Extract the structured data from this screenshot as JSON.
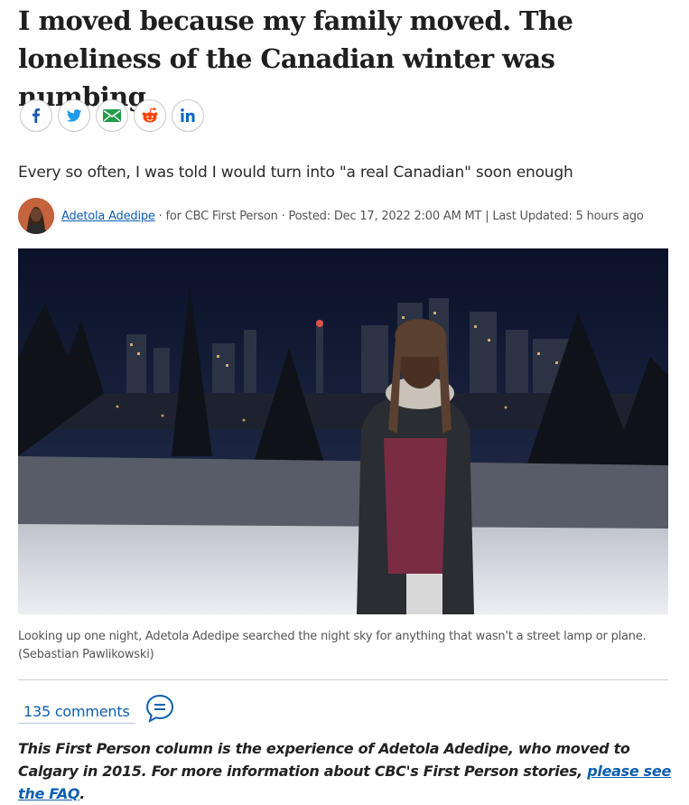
{
  "article": {
    "headline": "I moved because my family moved. The loneliness of the Canadian winter was numbing",
    "dek": "Every so often, I was told I would turn into \"a real Canadian\" soon enough",
    "share": [
      {
        "name": "facebook-share-button",
        "icon": "facebook-icon",
        "color": "#1a57b5"
      },
      {
        "name": "twitter-share-button",
        "icon": "twitter-icon",
        "color": "#1d9bf0"
      },
      {
        "name": "email-share-button",
        "icon": "email-icon",
        "color": "#1f9d49"
      },
      {
        "name": "reddit-share-button",
        "icon": "reddit-icon",
        "color": "#ff4500"
      },
      {
        "name": "linkedin-share-button",
        "icon": "linkedin-icon",
        "color": "#0a66c2"
      }
    ],
    "byline": {
      "author": "Adetola Adedipe",
      "source": " · for CBC First Person · ",
      "posted": "Posted: Dec 17, 2022 2:00 AM MT",
      "separator": " | ",
      "updated": "Last Updated: 5 hours ago"
    },
    "photo": {
      "caption": "Looking up one night, Adetola Adedipe searched the night sky for anything that wasn't a street lamp or plane. (Sebastian Pawlikowski)"
    },
    "comments": {
      "label": "135 comments",
      "icon": "comment-bubble-icon"
    },
    "note": {
      "text": "This First Person column is the experience of Adetola Adedipe, who moved to Calgary in 2015. For more information about CBC's First Person stories, ",
      "link": "please see the FAQ",
      "end": "."
    },
    "colors": {
      "link": "#0d5fb0",
      "text": "#222222"
    }
  }
}
